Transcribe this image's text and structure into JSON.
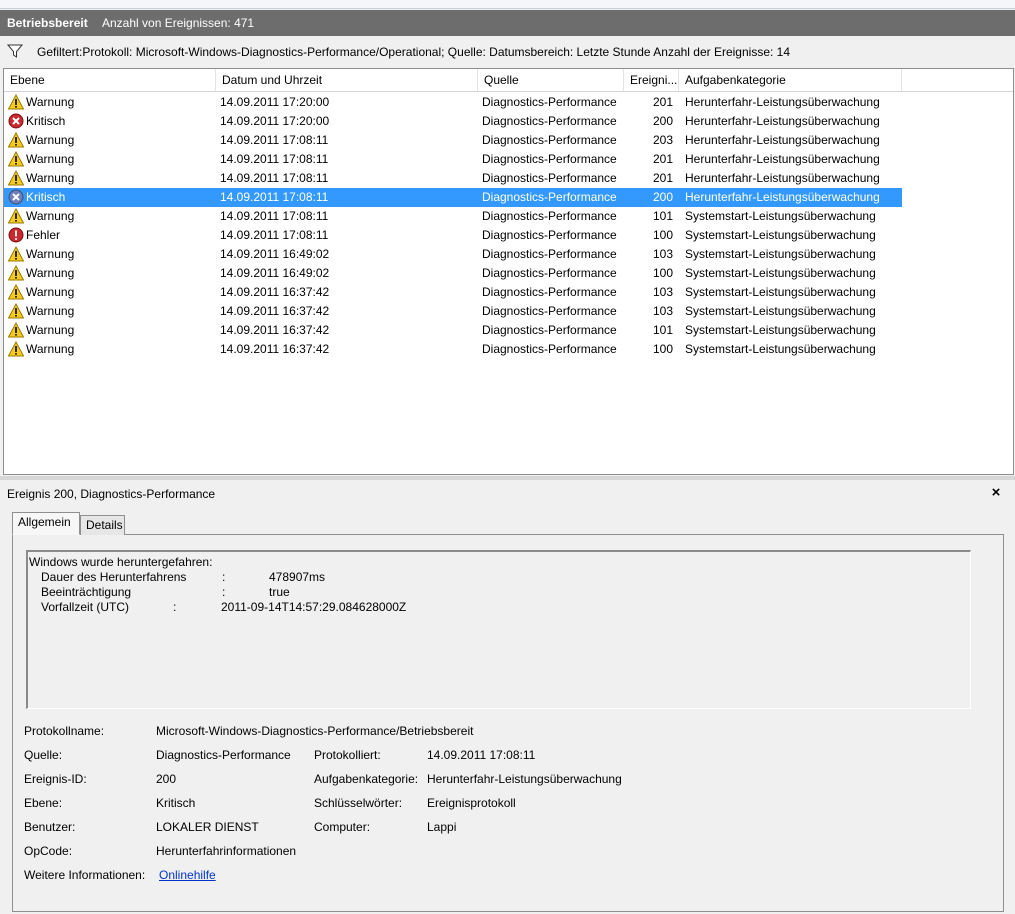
{
  "title_bar": {
    "log_name": "Betriebsbereit",
    "event_count": "Anzahl von Ereignissen: 471"
  },
  "filter_bar": {
    "text": "Gefiltert:Protokoll: Microsoft-Windows-Diagnostics-Performance/Operational; Quelle: Datumsbereich: Letzte Stunde Anzahl der Ereignisse: 14"
  },
  "columns": {
    "level": "Ebene",
    "date": "Datum und Uhrzeit",
    "source": "Quelle",
    "event_id": "Ereigni...",
    "category": "Aufgabenkategorie"
  },
  "rows": [
    {
      "icon": "warning",
      "level": "Warnung",
      "date": "14.09.2011 17:20:00",
      "source": "Diagnostics-Performance",
      "id": "201",
      "category": "Herunterfahr-Leistungsüberwachung"
    },
    {
      "icon": "critical",
      "level": "Kritisch",
      "date": "14.09.2011 17:20:00",
      "source": "Diagnostics-Performance",
      "id": "200",
      "category": "Herunterfahr-Leistungsüberwachung"
    },
    {
      "icon": "warning",
      "level": "Warnung",
      "date": "14.09.2011 17:08:11",
      "source": "Diagnostics-Performance",
      "id": "203",
      "category": "Herunterfahr-Leistungsüberwachung"
    },
    {
      "icon": "warning",
      "level": "Warnung",
      "date": "14.09.2011 17:08:11",
      "source": "Diagnostics-Performance",
      "id": "201",
      "category": "Herunterfahr-Leistungsüberwachung"
    },
    {
      "icon": "warning",
      "level": "Warnung",
      "date": "14.09.2011 17:08:11",
      "source": "Diagnostics-Performance",
      "id": "201",
      "category": "Herunterfahr-Leistungsüberwachung"
    },
    {
      "icon": "critical",
      "level": "Kritisch",
      "date": "14.09.2011 17:08:11",
      "source": "Diagnostics-Performance",
      "id": "200",
      "category": "Herunterfahr-Leistungsüberwachung",
      "selected": true
    },
    {
      "icon": "warning",
      "level": "Warnung",
      "date": "14.09.2011 17:08:11",
      "source": "Diagnostics-Performance",
      "id": "101",
      "category": "Systemstart-Leistungsüberwachung"
    },
    {
      "icon": "error",
      "level": "Fehler",
      "date": "14.09.2011 17:08:11",
      "source": "Diagnostics-Performance",
      "id": "100",
      "category": "Systemstart-Leistungsüberwachung"
    },
    {
      "icon": "warning",
      "level": "Warnung",
      "date": "14.09.2011 16:49:02",
      "source": "Diagnostics-Performance",
      "id": "103",
      "category": "Systemstart-Leistungsüberwachung"
    },
    {
      "icon": "warning",
      "level": "Warnung",
      "date": "14.09.2011 16:49:02",
      "source": "Diagnostics-Performance",
      "id": "100",
      "category": "Systemstart-Leistungsüberwachung"
    },
    {
      "icon": "warning",
      "level": "Warnung",
      "date": "14.09.2011 16:37:42",
      "source": "Diagnostics-Performance",
      "id": "103",
      "category": "Systemstart-Leistungsüberwachung"
    },
    {
      "icon": "warning",
      "level": "Warnung",
      "date": "14.09.2011 16:37:42",
      "source": "Diagnostics-Performance",
      "id": "103",
      "category": "Systemstart-Leistungsüberwachung"
    },
    {
      "icon": "warning",
      "level": "Warnung",
      "date": "14.09.2011 16:37:42",
      "source": "Diagnostics-Performance",
      "id": "101",
      "category": "Systemstart-Leistungsüberwachung"
    },
    {
      "icon": "warning",
      "level": "Warnung",
      "date": "14.09.2011 16:37:42",
      "source": "Diagnostics-Performance",
      "id": "100",
      "category": "Systemstart-Leistungsüberwachung"
    }
  ],
  "detail": {
    "header": "Ereignis 200, Diagnostics-Performance",
    "close": "×",
    "tabs": {
      "general": "Allgemein",
      "details": "Details"
    },
    "description": {
      "heading": "Windows wurde heruntergefahren:",
      "lines": [
        {
          "label": "Dauer des Herunterfahrens",
          "sep": ":",
          "value": "478907ms"
        },
        {
          "label": "Beeinträchtigung",
          "sep": ":",
          "value": "true"
        },
        {
          "label": "Vorfallzeit (UTC)",
          "sep": ":",
          "value": "2011-09-14T14:57:29.084628000Z"
        }
      ]
    },
    "props": {
      "log_name_label": "Protokollname:",
      "log_name": "Microsoft-Windows-Diagnostics-Performance/Betriebsbereit",
      "source_label": "Quelle:",
      "source": "Diagnostics-Performance",
      "logged_label": "Protokolliert:",
      "logged": "14.09.2011 17:08:11",
      "event_id_label": "Ereignis-ID:",
      "event_id": "200",
      "task_category_label": "Aufgabenkategorie:",
      "task_category": "Herunterfahr-Leistungsüberwachung",
      "level_label": "Ebene:",
      "level": "Kritisch",
      "keywords_label": "Schlüsselwörter:",
      "keywords": "Ereignisprotokoll",
      "user_label": "Benutzer:",
      "user": "LOKALER DIENST",
      "computer_label": "Computer:",
      "computer": "Lappi",
      "opcode_label": "OpCode:",
      "opcode": "Herunterfahrinformationen",
      "more_info_label": "Weitere Informationen:",
      "more_info_link": "Onlinehilfe"
    }
  },
  "colors": {
    "selection": "#3399ff",
    "titlebar": "#6d6d6d",
    "link": "#0033cc"
  }
}
